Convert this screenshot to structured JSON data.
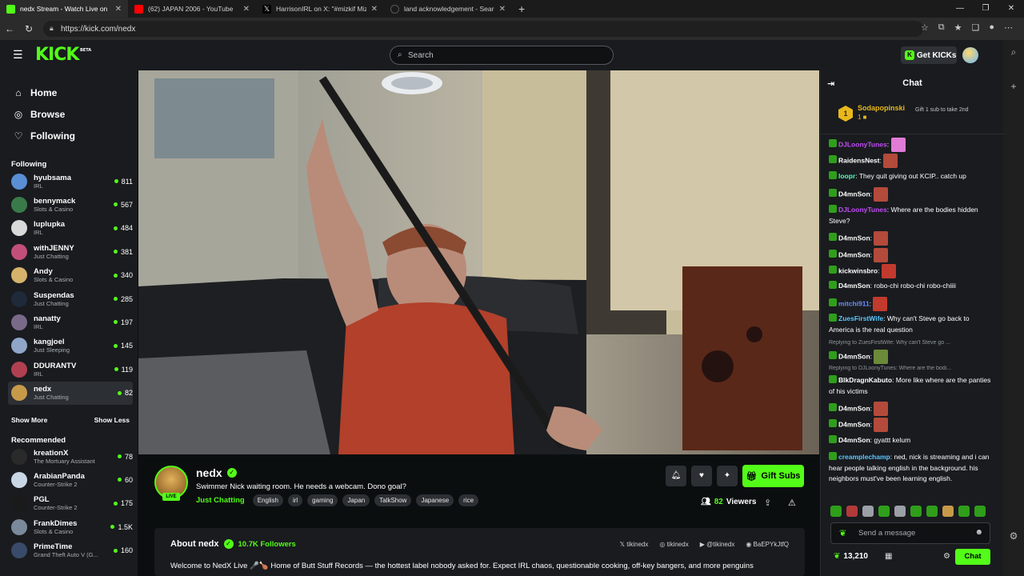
{
  "browser": {
    "tabs": [
      {
        "title": "nedx Stream - Watch Live on",
        "active": true,
        "color": "#53fc18"
      },
      {
        "title": "(62) JAPAN 2006 - YouTube",
        "active": false,
        "color": "#ff0000"
      },
      {
        "title": "HarrisonIRL on X: \"#mizkif Mizkif",
        "active": false,
        "color": "#ffffff"
      },
      {
        "title": "land acknowledgement - Search",
        "active": false,
        "color": "#3b78e7"
      }
    ],
    "url": "https://kick.com/nedx"
  },
  "header": {
    "logo": "KICK",
    "beta": "BETA",
    "search_placeholder": "Search",
    "get_kicks": "Get KICKs"
  },
  "sidebar": {
    "nav": [
      {
        "label": "Home",
        "icon": "home-icon"
      },
      {
        "label": "Browse",
        "icon": "compass-icon"
      },
      {
        "label": "Following",
        "icon": "heart-icon"
      }
    ],
    "following_title": "Following",
    "following": [
      {
        "name": "hyubsama",
        "category": "IRL",
        "viewers": "811",
        "color": "#5a8fd6"
      },
      {
        "name": "bennymack",
        "category": "Slots & Casino",
        "viewers": "567",
        "color": "#3a7a4a"
      },
      {
        "name": "luplupka",
        "category": "IRL",
        "viewers": "484",
        "color": "#d9d9d9"
      },
      {
        "name": "withJENNY",
        "category": "Just Chatting",
        "viewers": "381",
        "color": "#c24f7a"
      },
      {
        "name": "Andy",
        "category": "Slots & Casino",
        "viewers": "340",
        "color": "#d6b36a"
      },
      {
        "name": "Suspendas",
        "category": "Just Chatting",
        "viewers": "285",
        "color": "#1e2a3a"
      },
      {
        "name": "nanatty",
        "category": "IRL",
        "viewers": "197",
        "color": "#7a6a8a"
      },
      {
        "name": "kangjoel",
        "category": "Just Sleeping",
        "viewers": "145",
        "color": "#8fa6c9"
      },
      {
        "name": "DDURANTV",
        "category": "IRL",
        "viewers": "119",
        "color": "#b04050"
      },
      {
        "name": "nedx",
        "category": "Just Chatting",
        "viewers": "82",
        "color": "#c79a4a",
        "selected": true
      }
    ],
    "show_more": "Show More",
    "show_less": "Show Less",
    "recommended_title": "Recommended",
    "recommended": [
      {
        "name": "kreationX",
        "category": "The Mortuary Assistant",
        "viewers": "78",
        "color": "#2a2a2a"
      },
      {
        "name": "ArabianPanda",
        "category": "Counter-Strike 2",
        "viewers": "60",
        "color": "#c9d6e6"
      },
      {
        "name": "PGL",
        "category": "Counter-Strike 2",
        "viewers": "175",
        "color": "#1a1a1a"
      },
      {
        "name": "FrankDimes",
        "category": "Slots & Casino",
        "viewers": "1.5K",
        "color": "#7a8a9a"
      },
      {
        "name": "PrimeTime",
        "category": "Grand Theft Auto V (G...",
        "viewers": "160",
        "color": "#3a4a6a"
      }
    ]
  },
  "stream": {
    "name": "nedx",
    "live": "LIVE",
    "title": "Swimmer Nick waiting room. He needs a webcam. Dono goal?",
    "category": "Just Chatting",
    "tags": [
      "English",
      "irl",
      "gaming",
      "Japan",
      "TalkShow",
      "Japanese",
      "rice"
    ],
    "gift_subs": "Gift Subs",
    "viewers": "82",
    "viewers_label": "Viewers"
  },
  "about": {
    "title": "About nedx",
    "followers_count": "10.7K",
    "followers_label": "Followers",
    "socials": [
      "tikinedx",
      "tikinedx",
      "@tikinedx",
      "BaEPYkJtfQ"
    ],
    "text": "Welcome to NedX Live 🎤🍗 Home of Butt Stuff Records — the hottest label nobody asked for. Expect IRL chaos, questionable cooking, off-key bangers, and more penguins"
  },
  "chat": {
    "title": "Chat",
    "pinned": {
      "name": "Sodapopinski",
      "rank": "1",
      "count": "1",
      "gift_text": "Gift 1 sub to take 2nd"
    },
    "messages": [
      {
        "user": "DJLoonyTunes",
        "text": "",
        "color": "#c24cf6",
        "emote": true
      },
      {
        "user": "RaidensNest",
        "text": "",
        "color": "#ffffff",
        "emote": true
      },
      {
        "user": "loopr",
        "text": "They quit giving out KCIP.. catch up",
        "color": "#53fcb8"
      },
      {
        "user": "D4mnSon",
        "text": "",
        "color": "#ffffff",
        "emote": true
      },
      {
        "user": "DJLoonyTunes",
        "text": "Where are the bodies hidden Steve?",
        "color": "#c24cf6"
      },
      {
        "user": "D4mnSon",
        "text": "",
        "color": "#ffffff",
        "emote": true
      },
      {
        "user": "D4mnSon",
        "text": "",
        "color": "#ffffff",
        "emote": true
      },
      {
        "user": "kickwinsbro",
        "text": "",
        "color": "#ffffff",
        "emote": true
      },
      {
        "user": "D4mnSon",
        "text": "robo-chi robo-chi robo-chiiii",
        "color": "#ffffff"
      },
      {
        "user": "mitchi911",
        "text": "",
        "color": "#6a8cff",
        "emote": true
      },
      {
        "user": "ZuesFirstWife",
        "text": "Why can't Steve go back to America is the real question",
        "color": "#5cc8ff"
      },
      {
        "reply": "Replying to ZuesFirstWife: Why can't Steve go ..."
      },
      {
        "user": "D4mnSon",
        "text": "",
        "color": "#ffffff",
        "emote": true
      },
      {
        "reply": "Replying to DJLoonyTunes: Where are the bodi..."
      },
      {
        "user": "BlkDragnKabuto",
        "text": "More like where are the panties of his victims",
        "color": "#ffffff"
      },
      {
        "user": "D4mnSon",
        "text": "",
        "color": "#ffffff",
        "emote": true
      },
      {
        "user": "D4mnSon",
        "text": "",
        "color": "#ffffff",
        "emote": true
      },
      {
        "user": "D4mnSon",
        "text": "gyattt kelum",
        "color": "#ffffff"
      },
      {
        "user": "creamplechamp",
        "text": "ned, nick is streaming and i can hear people talking english in the background. his neighbors must've been learning english.",
        "color": "#5cc8ff"
      }
    ],
    "input_placeholder": "Send a message",
    "kicks_balance": "13,210",
    "send_label": "Chat"
  }
}
